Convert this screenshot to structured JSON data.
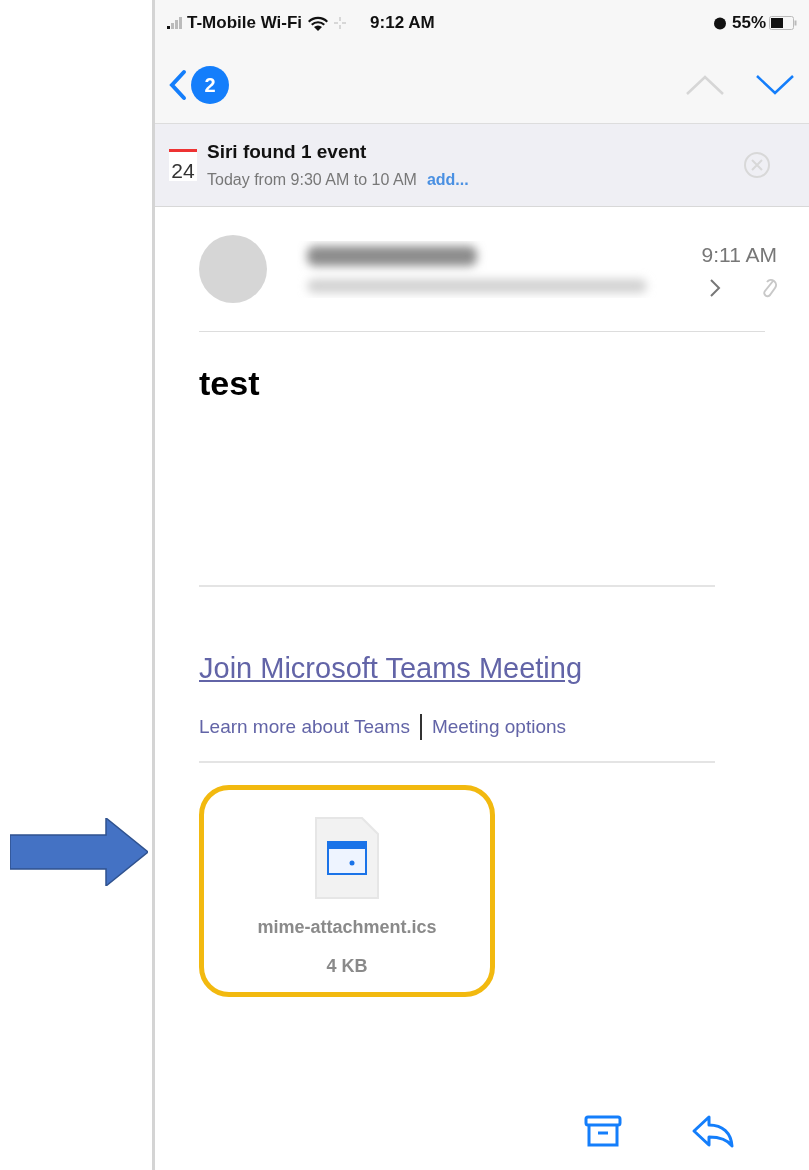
{
  "status_bar": {
    "carrier": "T-Mobile Wi-Fi",
    "time": "9:12 AM",
    "battery": "55%"
  },
  "nav_bar": {
    "unread_badge": "2"
  },
  "siri_banner": {
    "calendar_day": "24",
    "title": "Siri found 1 event",
    "detail": "Today from 9:30 AM to 10 AM",
    "action": "add..."
  },
  "message": {
    "time": "9:11 AM",
    "has_attachment": true,
    "subject": "test",
    "teams": {
      "join_link": "Join Microsoft Teams Meeting",
      "learn_link": "Learn more about Teams",
      "options_link": "Meeting options"
    },
    "attachment": {
      "name": "mime-attachment.ics",
      "size": "4 KB",
      "highlighted": true
    }
  }
}
